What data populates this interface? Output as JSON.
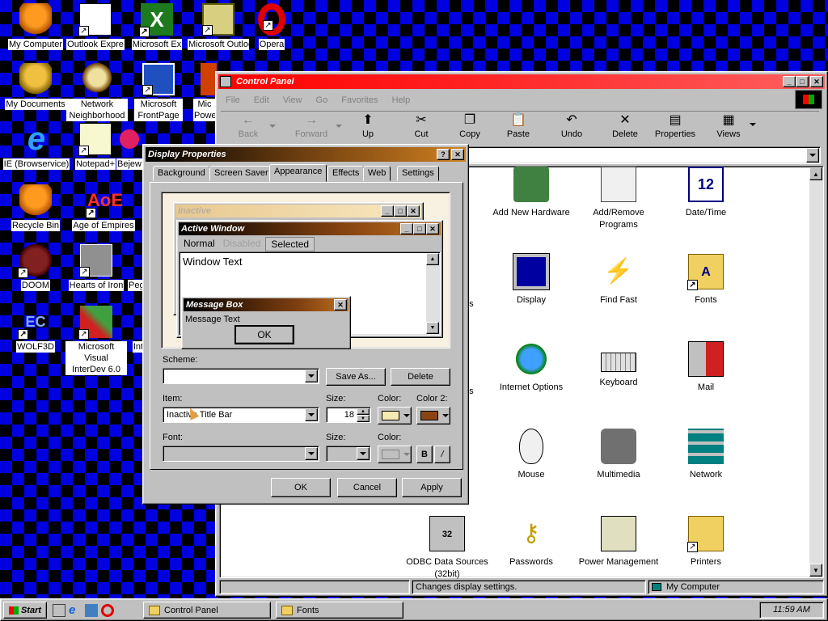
{
  "desktop": {
    "icons": [
      {
        "label": "My Computer"
      },
      {
        "label": "Outlook Expre"
      },
      {
        "label": "Microsoft Ex"
      },
      {
        "label": "Microsoft Outlook"
      },
      {
        "label": "Opera"
      },
      {
        "label": "My Documents"
      },
      {
        "label": "Network Neighborhood"
      },
      {
        "label": "Microsoft FrontPage"
      },
      {
        "label": "Mic Powe"
      },
      {
        "label": "IE (Browservice)"
      },
      {
        "label": "Notepad+"
      },
      {
        "label": "Bejew"
      },
      {
        "label": "Recycle Bin"
      },
      {
        "label": "Age of Empires"
      },
      {
        "label": "DOOM"
      },
      {
        "label": "Hearts of Iron"
      },
      {
        "label": "Peg"
      },
      {
        "label": "WOLF3D"
      },
      {
        "label": "Microsoft Visual InterDev 6.0"
      },
      {
        "label": "Int"
      }
    ]
  },
  "control_panel": {
    "title": "Control Panel",
    "menu": [
      "File",
      "Edit",
      "View",
      "Go",
      "Favorites",
      "Help"
    ],
    "toolbar": [
      {
        "label": "Back"
      },
      {
        "label": "Forward"
      },
      {
        "label": "Up"
      },
      {
        "label": "Cut"
      },
      {
        "label": "Copy"
      },
      {
        "label": "Paste"
      },
      {
        "label": "Undo"
      },
      {
        "label": "Delete"
      },
      {
        "label": "Properties"
      },
      {
        "label": "Views"
      }
    ],
    "items": [
      {
        "label": "Add New Hardware"
      },
      {
        "label": "Add/Remove Programs"
      },
      {
        "label": "Date/Time"
      },
      {
        "label": "Display"
      },
      {
        "label": "Find Fast"
      },
      {
        "label": "Fonts"
      },
      {
        "label": "Internet Options"
      },
      {
        "label": "Keyboard"
      },
      {
        "label": "Mail"
      },
      {
        "label": "Mouse"
      },
      {
        "label": "Multimedia"
      },
      {
        "label": "Network"
      },
      {
        "label": "ODBC Data Sources (32bit)"
      },
      {
        "label": "Passwords"
      },
      {
        "label": "Power Management"
      },
      {
        "label": "Printers"
      }
    ],
    "partial_labels": [
      "y",
      "es",
      "ns"
    ],
    "status": "Changes display settings.",
    "status_right": "My Computer"
  },
  "dialog": {
    "title": "Display Properties",
    "tabs": [
      "Background",
      "Screen Saver",
      "Appearance",
      "Effects",
      "Web",
      "Settings"
    ],
    "preview": {
      "inactive": "Inactive",
      "active": "Active Window",
      "menu_normal": "Normal",
      "menu_disabled": "Disabled",
      "menu_selected": "Selected",
      "window_text": "Window Text",
      "msgbox_title": "Message Box",
      "msgbox_text": "Message Text",
      "ok": "OK"
    },
    "scheme_label": "Scheme:",
    "scheme_value": "",
    "save_as": "Save As...",
    "delete": "Delete",
    "item_label": "Item:",
    "item_value": "Inactive Title Bar",
    "size_label": "Size:",
    "size_value": "18",
    "color_label": "Color:",
    "color2_label": "Color 2:",
    "font_label": "Font:",
    "font_size_label": "Size:",
    "font_color_label": "Color:",
    "bold": "B",
    "italic": "/",
    "ok": "OK",
    "cancel": "Cancel",
    "apply": "Apply",
    "help": "?",
    "close": "✕"
  },
  "taskbar": {
    "start": "Start",
    "tasks": [
      "Control Panel",
      "Fonts"
    ],
    "clock": "11:59 AM"
  },
  "colors": {
    "title_active_left": "#ff0000",
    "dialog_title_left": "#000000",
    "dialog_title_right": "#d08020",
    "swatch_color": "#f7e7b0",
    "swatch_color2": "#8b4513"
  }
}
